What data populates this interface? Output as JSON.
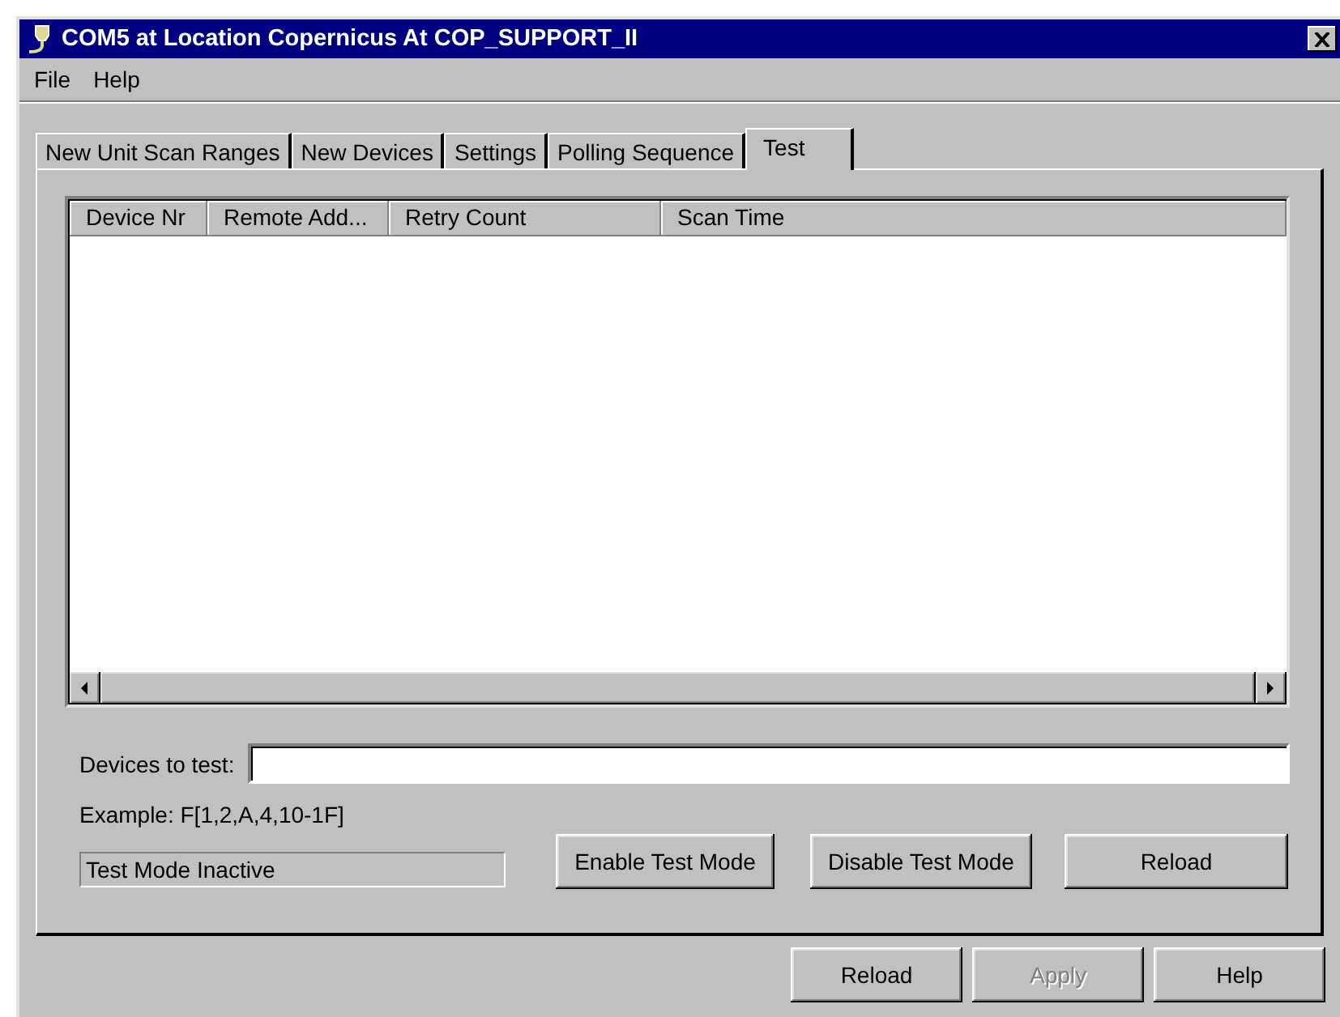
{
  "window": {
    "title": "COM5 at Location Copernicus At COP_SUPPORT_II"
  },
  "menu": [
    "File",
    "Help"
  ],
  "tabs": [
    {
      "label": "New Unit Scan Ranges",
      "selected": false
    },
    {
      "label": "New Devices",
      "selected": false
    },
    {
      "label": "Settings",
      "selected": false
    },
    {
      "label": "Polling Sequence",
      "selected": false
    },
    {
      "label": "Test",
      "selected": true
    }
  ],
  "table": {
    "columns": [
      "Device Nr",
      "Remote Add...",
      "Retry Count",
      "Scan Time"
    ]
  },
  "devices_field": {
    "label": "Devices to test:"
  },
  "example": "Example: F[1,2,A,4,10-1F]",
  "status": "Test Mode Inactive",
  "panel_buttons": [
    {
      "label": "Enable Test Mode",
      "disabled": false
    },
    {
      "label": "Disable Test Mode",
      "disabled": false
    },
    {
      "label": "Reload",
      "disabled": false
    }
  ],
  "dialog_buttons": [
    {
      "label": "Reload",
      "disabled": false
    },
    {
      "label": "Apply",
      "disabled": true
    },
    {
      "label": "Help",
      "disabled": false
    }
  ]
}
